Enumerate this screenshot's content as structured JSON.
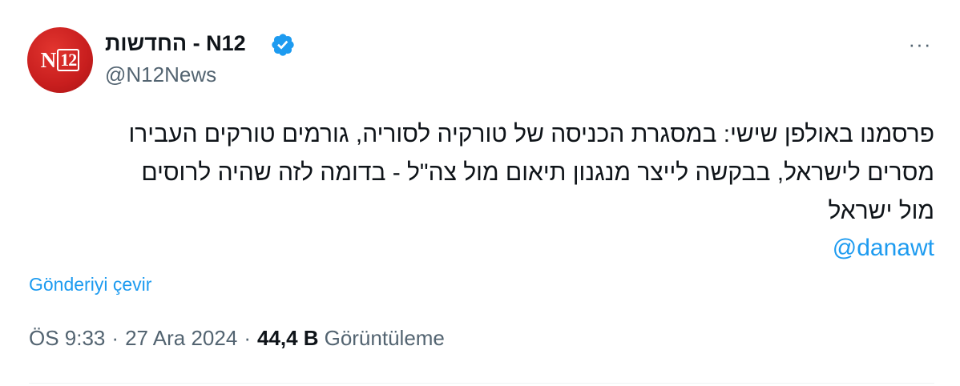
{
  "author": {
    "display_name": "N12 - החדשות",
    "handle": "@N12News",
    "avatar_text": "N",
    "avatar_number": "12",
    "verified": true,
    "verified_color": "#1d9bf0"
  },
  "menu": {
    "more_icon": "more-horizontal-icon",
    "more_label": "···"
  },
  "tweet": {
    "lines": [
      "פרסמנו באולפן שישי: במסגרת הכניסה של טורקיה לסוריה, גורמים טורקים העבירו",
      "מסרים לישראל, בבקשה לייצר מנגנון תיאום מול צה\"ל - בדומה לזה שהיה לרוסים",
      "מול ישראל"
    ],
    "mention": "@danawt",
    "translate_label": "Gönderiyi çevir"
  },
  "meta": {
    "time": "ÖS 9:33",
    "separator": "·",
    "date": "27 Ara 2024",
    "views_count": "44,4 B",
    "views_label": "Görüntüleme"
  },
  "colors": {
    "accent": "#1d9bf0",
    "text": "#0f1419",
    "secondary": "#536471",
    "avatar_red": "#c81e1e"
  }
}
